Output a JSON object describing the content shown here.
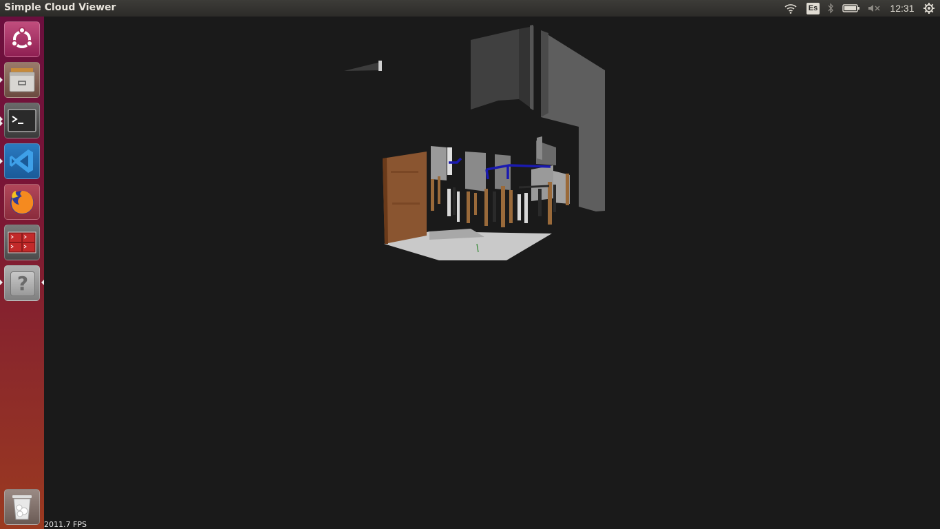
{
  "window": {
    "title": "Simple Cloud Viewer"
  },
  "top_panel": {
    "keyboard_layout": "Es",
    "clock": "12:31",
    "indicators": [
      "wifi-icon",
      "bluetooth-icon",
      "battery-icon",
      "volume-muted-icon",
      "settings-gear-icon"
    ]
  },
  "launcher": {
    "items": [
      {
        "name": "ubuntu-dash",
        "icon": "ubuntu-logo-icon"
      },
      {
        "name": "files",
        "icon": "file-cabinet-icon"
      },
      {
        "name": "terminal",
        "icon": "terminal-icon"
      },
      {
        "name": "vscode",
        "icon": "vscode-icon"
      },
      {
        "name": "firefox",
        "icon": "firefox-icon"
      },
      {
        "name": "multi-terminal",
        "icon": "terminal-grid-icon"
      },
      {
        "name": "unknown-app",
        "icon": "question-mark-icon",
        "glyph": "?"
      },
      {
        "name": "trash",
        "icon": "trash-icon"
      }
    ]
  },
  "viewer": {
    "fps_label": "2011.7 FPS"
  },
  "colors": {
    "panel_bg": "#2c2b28",
    "launcher_top": "#6b0f3e",
    "launcher_bottom": "#9b3a20",
    "viewport_bg": "#1a1a1a"
  }
}
